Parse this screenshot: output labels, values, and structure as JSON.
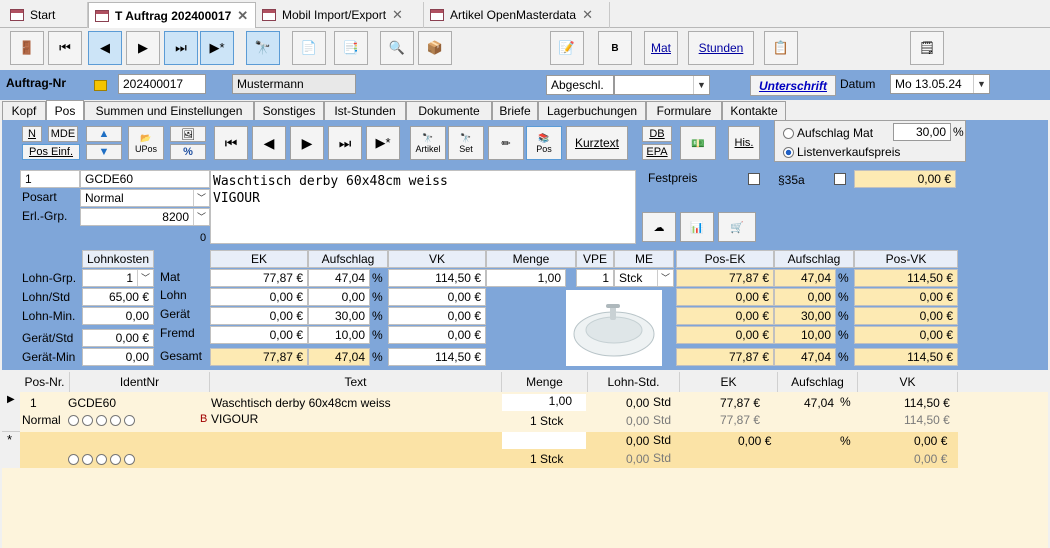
{
  "tabs": [
    {
      "label": "Start"
    },
    {
      "label": "T Auftrag 202400017"
    },
    {
      "label": "Mobil Import/Export"
    },
    {
      "label": "Artikel OpenMasterdata"
    }
  ],
  "toolbar": {
    "mat": "Mat",
    "stunden": "Stunden",
    "b": "B"
  },
  "header": {
    "auftrag_label": "Auftrag-Nr",
    "auftrag_nr": "202400017",
    "name": "Mustermann",
    "status": "Abgeschl.",
    "unterschrift": "Unterschrift",
    "datum_label": "Datum",
    "datum": "Mo 13.05.24"
  },
  "subtabs": [
    "Kopf",
    "Pos",
    "Summen und Einstellungen",
    "Sonstiges",
    "Ist-Stunden",
    "Dokumente",
    "Briefe",
    "Lagerbuchungen",
    "Formulare",
    "Kontakte"
  ],
  "pos_toolbar": {
    "n": "N",
    "mde": "MDE",
    "pos_einf": "Pos Einf.",
    "upos": "UPos",
    "pct": "%",
    "artikel": "Artikel",
    "set": "Set",
    "pos": "Pos",
    "kurztext": "Kurztext",
    "db": "DB",
    "epa": "EPA",
    "his": "His.",
    "aufschlag_mat": "Aufschlag Mat",
    "aufschlag_mat_val": "30,00",
    "pct_sign": "%",
    "listenvk": "Listenverkaufspreis"
  },
  "position": {
    "nr": "1",
    "ident": "GCDE60",
    "text1": "Waschtisch derby 60x48cm weiss",
    "text2": "VIGOUR",
    "posart_label": "Posart",
    "posart": "Normal",
    "erl_label": "Erl.-Grp.",
    "erl": "8200",
    "zero": "0",
    "festpreis": "Festpreis",
    "p35a": "§35a",
    "p35a_val": "0,00 €"
  },
  "calc": {
    "lohnkosten": "Lohnkosten",
    "lohn_grp_label": "Lohn-Grp.",
    "lohn_grp": "1",
    "lohn_std_label": "Lohn/Std",
    "lohn_std": "65,00 €",
    "lohn_min_label": "Lohn-Min.",
    "lohn_min": "0,00",
    "geraet_std_label": "Gerät/Std",
    "geraet_std": "0,00 €",
    "geraet_min_label": "Gerät-Min",
    "geraet_min": "0,00",
    "cols": {
      "ek": "EK",
      "aufschlag": "Aufschlag",
      "vk": "VK",
      "menge": "Menge",
      "vpe": "VPE",
      "me": "ME",
      "pos_ek": "Pos-EK",
      "aufschlag2": "Aufschlag",
      "pos_vk": "Pos-VK"
    },
    "rows": [
      {
        "label": "Mat",
        "ek": "77,87 €",
        "auf": "47,04",
        "vk": "114,50 €",
        "pek": "77,87 €",
        "pauf": "47,04",
        "pvk": "114,50 €"
      },
      {
        "label": "Lohn",
        "ek": "0,00 €",
        "auf": "0,00",
        "vk": "0,00 €",
        "pek": "0,00 €",
        "pauf": "0,00",
        "pvk": "0,00 €"
      },
      {
        "label": "Gerät",
        "ek": "0,00 €",
        "auf": "30,00",
        "vk": "0,00 €",
        "pek": "0,00 €",
        "pauf": "30,00",
        "pvk": "0,00 €"
      },
      {
        "label": "Fremd",
        "ek": "0,00 €",
        "auf": "10,00",
        "vk": "0,00 €",
        "pek": "0,00 €",
        "pauf": "10,00",
        "pvk": "0,00 €"
      },
      {
        "label": "Gesamt",
        "ek": "77,87 €",
        "auf": "47,04",
        "vk": "114,50 €",
        "pek": "77,87 €",
        "pauf": "47,04",
        "pvk": "114,50 €"
      }
    ],
    "menge": "1,00",
    "vpe": "1",
    "me": "Stck",
    "pct": "%"
  },
  "grid": {
    "headers": [
      "Pos-Nr.",
      "IdentNr",
      "Text",
      "Menge",
      "Lohn-Std.",
      "EK",
      "Aufschlag",
      "VK"
    ],
    "row1": {
      "nr": "1",
      "ident": "GCDE60",
      "text1": "Waschtisch derby 60x48cm weiss",
      "text2": "VIGOUR",
      "b": "B",
      "posart": "Normal",
      "menge": "1,00",
      "menge2": "1 Stck",
      "lohn": "0,00",
      "std": "Std",
      "lohn2": "0,00",
      "std2": "Std",
      "ek": "77,87 €",
      "ek2": "77,87 €",
      "auf": "47,04",
      "pct": "%",
      "vk": "114,50 €",
      "vk2": "114,50 €"
    },
    "row2": {
      "menge2": "1 Stck",
      "lohn": "0,00",
      "std": "Std",
      "lohn2": "0,00",
      "std2": "Std",
      "ek": "0,00 €",
      "pct": "%",
      "vk": "0,00 €",
      "vk2": "0,00 €",
      "star": "*"
    }
  }
}
